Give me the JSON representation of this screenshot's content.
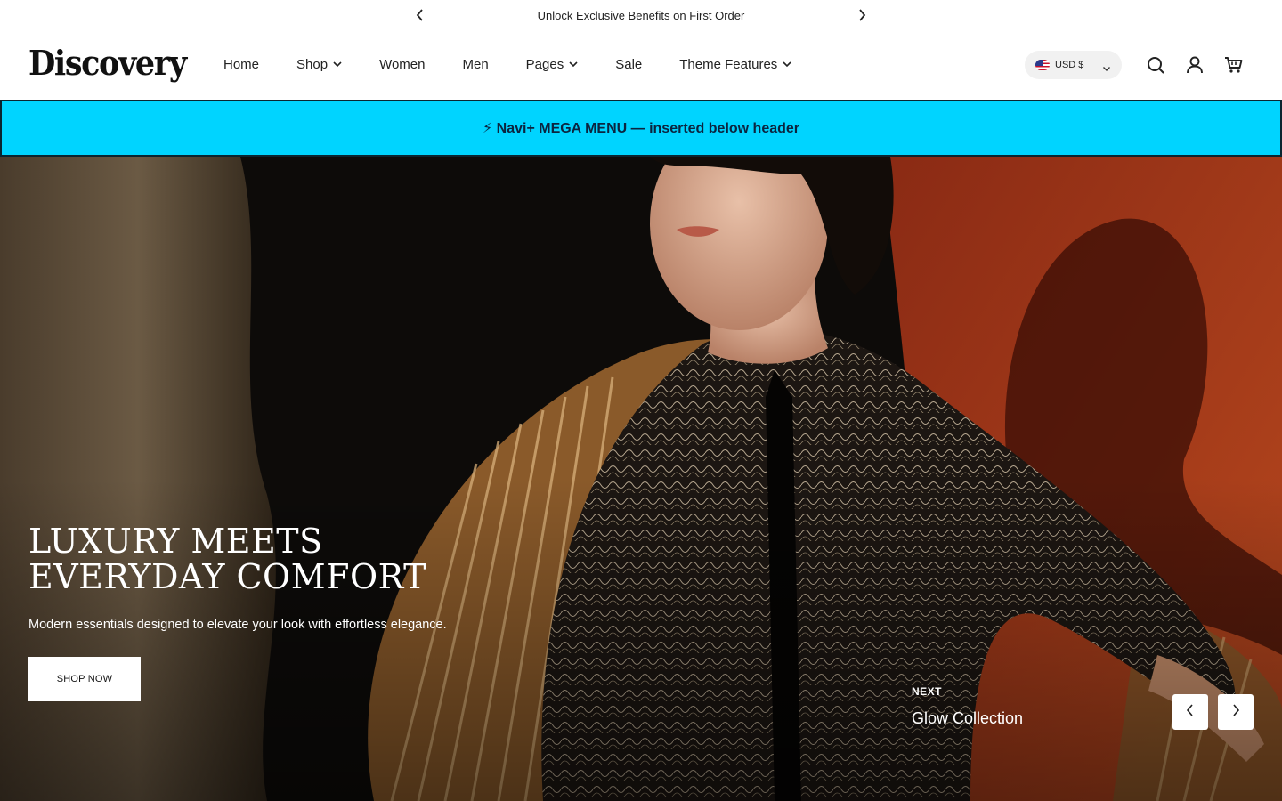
{
  "announcement": {
    "text": "Unlock Exclusive Benefits on First Order",
    "prev_icon": "chevron-left-icon",
    "next_icon": "chevron-right-icon"
  },
  "header": {
    "logo": "Discovery",
    "nav": [
      {
        "label": "Home",
        "has_dropdown": false
      },
      {
        "label": "Shop",
        "has_dropdown": true
      },
      {
        "label": "Women",
        "has_dropdown": false
      },
      {
        "label": "Men",
        "has_dropdown": false
      },
      {
        "label": "Pages",
        "has_dropdown": true
      },
      {
        "label": "Sale",
        "has_dropdown": false
      },
      {
        "label": "Theme Features",
        "has_dropdown": true
      }
    ],
    "currency": {
      "label": "USD $",
      "flag": "us-flag-icon"
    },
    "icons": [
      "search-icon",
      "account-icon",
      "cart-icon"
    ]
  },
  "mega_banner": {
    "text": "⚡ Navi+ MEGA MENU — inserted below header",
    "background": "#00d4ff",
    "text_color": "#0b2540"
  },
  "hero": {
    "title_line1": "LUXURY MEETS",
    "title_line2": "EVERYDAY COMFORT",
    "subtitle": "Modern essentials designed to elevate your look with effortless elegance.",
    "button": "SHOP NOW",
    "next_label": "NEXT",
    "next_title": "Glow Collection"
  }
}
